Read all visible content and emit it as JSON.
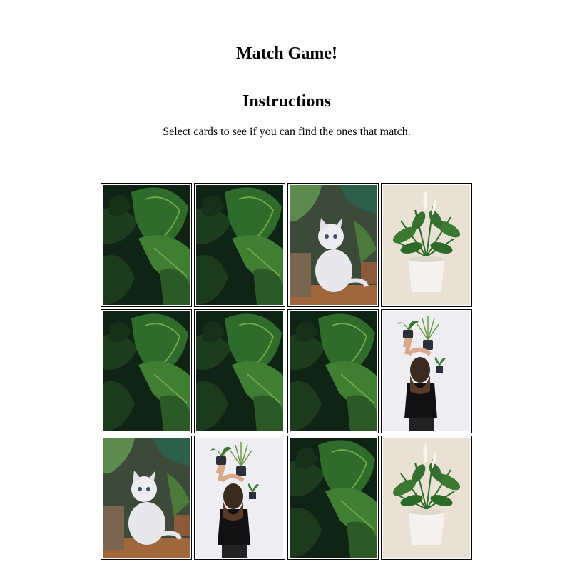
{
  "title": "Match Game!",
  "instructions_heading": "Instructions",
  "instructions_text": "Select cards to see if you can find the ones that match.",
  "palette": {
    "leaf_dark": "#0f2414",
    "leaf_mid": "#2f6b2a",
    "leaf_light": "#6ea84a",
    "cat_bg": "#3d4a3a",
    "wood": "#a0673c",
    "beige": "#e8e1d4",
    "pot_white": "#f4f2ee",
    "wall_white": "#eeeef2",
    "shirt_black": "#111111",
    "hair": "#3a2a20"
  },
  "cards": [
    {
      "image": "monstera-leaves"
    },
    {
      "image": "monstera-leaves"
    },
    {
      "image": "kitten-plants"
    },
    {
      "image": "peace-lily-pot"
    },
    {
      "image": "monstera-leaves"
    },
    {
      "image": "monstera-leaves"
    },
    {
      "image": "monstera-leaves"
    },
    {
      "image": "woman-holding-plants"
    },
    {
      "image": "kitten-plants"
    },
    {
      "image": "woman-holding-plants"
    },
    {
      "image": "monstera-leaves"
    },
    {
      "image": "peace-lily-pot"
    }
  ]
}
